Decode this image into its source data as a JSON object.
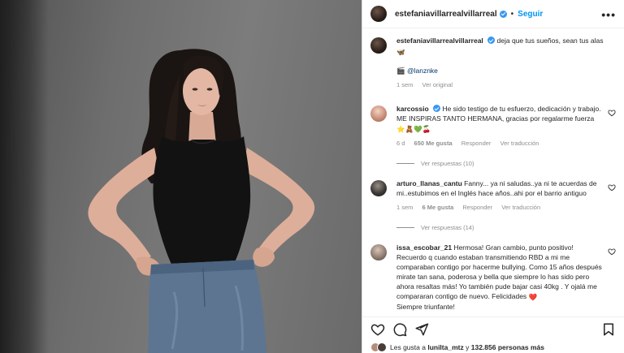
{
  "header": {
    "username": "estefaniavillarrealvillarreal",
    "dot": "•",
    "follow_label": "Seguir",
    "more_label": "•••"
  },
  "caption": {
    "username": "estefaniavillarrealvillarreal",
    "text": "deja que tus sueños, sean tus alas",
    "emoji": "🦋",
    "credit_emoji": "🎬",
    "credit_mention": "@lanznke",
    "time": "1 sem",
    "see_translation": "Ver original"
  },
  "comments": [
    {
      "username": "karcossio",
      "verified": true,
      "text": "He sido testigo de tu esfuerzo, dedicación y trabajo. ME INSPIRAS TANTO HERMANA, gracias por regalarme fuerza",
      "emojis": "⭐🧸💚🍒",
      "time": "6 d",
      "likes": "650 Me gusta",
      "reply": "Responder",
      "translate": "Ver traducción",
      "replies": "Ver respuestas (10)"
    },
    {
      "username": "arturo_llanas_cantu",
      "verified": false,
      "text": "Fanny... ya ni saludas..ya ni te acuerdas de mi..estubimos en el Inglés hace años..ahi por el barrio antiguo",
      "emojis": "",
      "time": "1 sem",
      "likes": "6 Me gusta",
      "reply": "Responder",
      "translate": "Ver traducción",
      "replies": "Ver respuestas (14)"
    },
    {
      "username": "issa_escobar_21",
      "verified": false,
      "text": "Hermosa! Gran cambio, punto positivo! Recuerdo q cuando estaban transmitiendo RBD a mi me comparaban contigo por hacerme bullying. Como 15 años después mirate tan sana, poderosa y bella que siempre lo has sido pero ahora resaltas más! Yo también pude bajar casi 40kg . Y ojalá me compararan contigo de nuevo. Felicidades",
      "emojis": "❤️",
      "tail": "Siempre triunfante!"
    }
  ],
  "likes_line": {
    "prefix": "Les gusta a",
    "user": "lunilta_mtz",
    "middle": "y",
    "count": "132.856 personas más"
  },
  "colors": {
    "accent": "#0095f6",
    "verified": "#3897f0",
    "muted": "#8e8e8e"
  }
}
